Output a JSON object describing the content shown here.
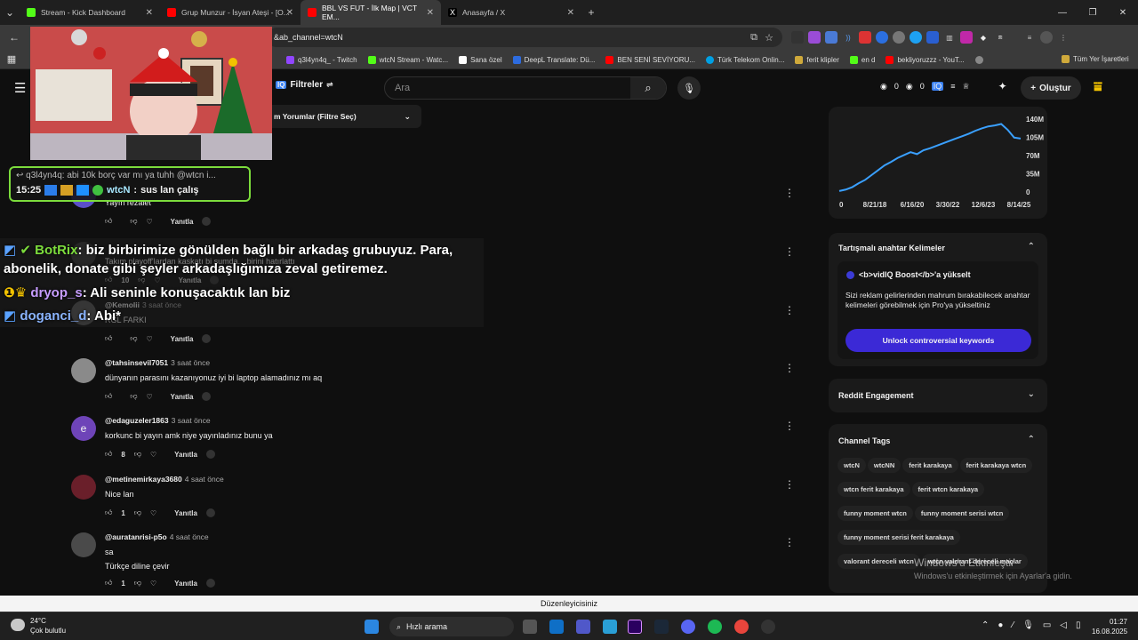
{
  "browser": {
    "tabs": [
      {
        "label": "Stream - Kick Dashboard",
        "color": "#53fc18"
      },
      {
        "label": "Grup Munzur - İsyan Ateşi - [O...",
        "color": "#ff0000"
      },
      {
        "label": "BBL VS FUT - İlk Map | VCT EM...",
        "color": "#ff0000"
      },
      {
        "label": "Anasayfa / X",
        "color": "#ffffff"
      }
    ],
    "url": "&ab_channel=wtcN",
    "bookmarks": [
      {
        "label": "q3l4yn4q_ - Twitch",
        "color": "#9146ff"
      },
      {
        "label": "wtcN Stream - Watc...",
        "color": "#53fc18"
      },
      {
        "label": "Sana özel",
        "color": "#ffffff"
      },
      {
        "label": "DeepL Translate: Dü...",
        "color": "#0f2b46"
      },
      {
        "label": "BEN SENİ SEVİYORU...",
        "color": "#ff0000"
      },
      {
        "label": "Türk Telekom Onlin...",
        "color": "#00a0e3"
      },
      {
        "label": "ferit klipler",
        "color": "#cfa93b"
      },
      {
        "label": "en d",
        "color": "#53fc18"
      },
      {
        "label": "bekliyoruzzz - YouT...",
        "color": "#ff0000"
      },
      {
        "label": "Tüm Yer İşaretleri",
        "color": "#cfa93b"
      }
    ]
  },
  "youtube": {
    "filters_label": "Filtreler",
    "search_placeholder": "Ara",
    "create_label": "Oluştur",
    "counter_a": "0",
    "counter_b": "0",
    "sort_label": "m Yorumlar (Filtre Seç)",
    "reply_label": "Yanıtla"
  },
  "comments": [
    {
      "author": "",
      "time": "",
      "text": "Yayın rezalet",
      "likes": "",
      "avatar_color": "#5b4fc9"
    },
    {
      "author": "",
      "time": "",
      "text": "Takım playoff'lardan kaskatı bi şumda... birini hatırlattı",
      "likes": "10",
      "avatar_color": "#333"
    },
    {
      "author": "@Kemolii",
      "time": "3 saat önce",
      "text": "RGL FARKI",
      "likes": "",
      "avatar_color": "#555"
    },
    {
      "author": "@tahsinsevil7051",
      "time": "3 saat önce",
      "text": "dünyanın parasını kazanıyonuz iyi bi laptop alamadınız mı aq",
      "likes": "",
      "avatar_color": "#8a8a8a"
    },
    {
      "author": "@edaguzeler1863",
      "time": "3 saat önce",
      "text": "korkunc bi yayın amk niye yayınladınız bunu ya",
      "likes": "8",
      "avatar_color": "#6e44b8",
      "avatar_letter": "e"
    },
    {
      "author": "@metinemirkaya3680",
      "time": "4 saat önce",
      "text": "Nice lan",
      "likes": "1",
      "avatar_color": "#6a1f2a"
    },
    {
      "author": "@auratanrisi-p5o",
      "time": "4 saat önce",
      "text": "sa\nTürkçe diline çevir",
      "likes": "1",
      "avatar_color": "#4a4a4a"
    }
  ],
  "stream_chat": {
    "top_msg": "q3l4yn4q: abi 10k borç var mı ya tuhh @wtcn i...",
    "time": "15:25",
    "user": "wtcN",
    "msg": "sus lan çalış"
  },
  "overlay_chat": [
    {
      "user": "BotRix",
      "user_color": "#7cdc3c",
      "msg": ": biz birbirimize gönülden bağlı bir arkadaş grubuyuz. Para,"
    },
    {
      "user": "",
      "user_color": "#ffffff",
      "msg": "abonelik, donate gibi şeyler arkadaşlığımıza zeval getiremez."
    },
    {
      "user": "dryop_s",
      "user_color": "#c69cff",
      "msg": ": Ali seninle konuşacaktık lan biz"
    },
    {
      "user": "doganci_d",
      "user_color": "#8ab4ff",
      "msg": ": Abi*"
    }
  ],
  "sidebar": {
    "chart_data": {
      "type": "line",
      "x_ticks": [
        "0",
        "8/21/18",
        "6/16/20",
        "3/30/22",
        "12/6/23",
        "8/14/25"
      ],
      "y_ticks": [
        "140M",
        "105M",
        "70M",
        "35M",
        "0"
      ],
      "ylim": [
        0,
        150
      ],
      "series": [
        {
          "values": [
            2,
            5,
            10,
            18,
            25,
            35,
            45,
            55,
            62,
            70,
            76,
            82,
            78,
            86,
            90,
            95,
            100,
            105,
            110,
            115,
            120,
            126,
            131,
            135,
            137,
            140,
            128,
            112,
            110
          ]
        }
      ]
    },
    "controversial": {
      "title": "Tartışmalı anahtar Kelimeler",
      "promo_title": "<b>vidIQ Boost</b>'a yükselt",
      "promo_body": "Sizi reklam gelirlerinden mahrum bırakabilecek anahtar kelimeleri görebilmek için Pro'ya yükseltiniz",
      "cta": "Unlock controversial keywords"
    },
    "reddit_title": "Reddit Engagement",
    "tags_title": "Channel Tags",
    "tags": [
      "wtcN",
      "wtcNN",
      "ferit karakaya",
      "ferit karakaya wtcn",
      "wtcn ferit karakaya",
      "ferit wtcn karakaya",
      "funny moment wtcn",
      "funny moment serisi wtcn",
      "funny moment serisi ferit karakaya",
      "valorant dereceli wtcn",
      "wtcn valorant dereceli maçlar"
    ]
  },
  "windows": {
    "activate_title": "Windows'u Etkinleştir",
    "activate_body": "Windows'u etkinleştirmek için Ayarlar'a gidin.",
    "status_bar": "Düzenleyicisiniz",
    "weather_temp": "24°C",
    "weather_desc": "Çok bulutlu",
    "search_label": "Hızlı arama",
    "clock_time": "01:27",
    "clock_date": "16.08.2025"
  }
}
